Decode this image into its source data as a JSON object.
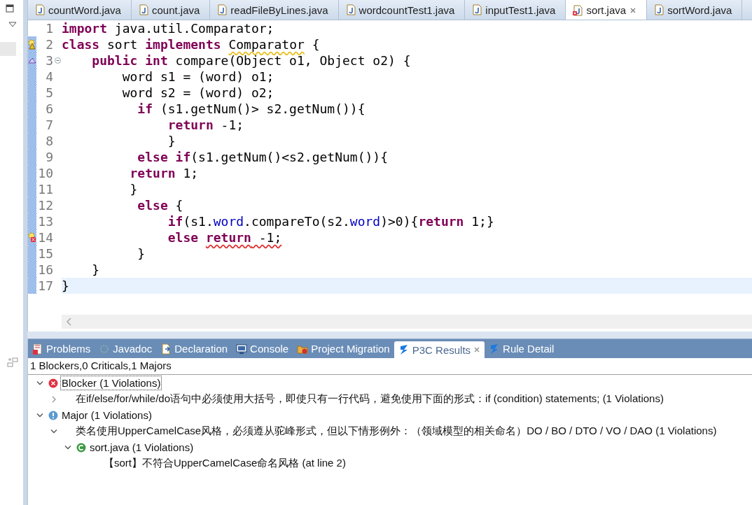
{
  "editor_tabs": [
    {
      "label": "countWord.java",
      "selected": false,
      "error": false
    },
    {
      "label": "count.java",
      "selected": false,
      "error": false
    },
    {
      "label": "readFileByLines.java",
      "selected": false,
      "error": false
    },
    {
      "label": "wordcountTest1.java",
      "selected": false,
      "error": false
    },
    {
      "label": "inputTest1.java",
      "selected": false,
      "error": false
    },
    {
      "label": "sort.java",
      "selected": true,
      "error": true
    },
    {
      "label": "sortWord.java",
      "selected": false,
      "error": false
    }
  ],
  "code_lines": [
    {
      "number": "1",
      "kind": "plain",
      "changed": false,
      "current": false,
      "segments": [
        {
          "text": "import",
          "kind": "keyword"
        },
        {
          "text": " java.util.Comparator;",
          "kind": "plain"
        }
      ]
    },
    {
      "number": "2",
      "kind": "warning",
      "changed": true,
      "current": false,
      "segments": [
        {
          "text": "class",
          "kind": "keyword"
        },
        {
          "text": " sort ",
          "kind": "plain"
        },
        {
          "text": "implements ",
          "kind": "keyword"
        },
        {
          "text": "Comparator",
          "kind": "plain",
          "warning": true
        },
        {
          "text": " {",
          "kind": "plain"
        }
      ]
    },
    {
      "number": "3",
      "kind": "override",
      "expanded": true,
      "changed": true,
      "current": false,
      "segments": [
        {
          "text": "    public int",
          "kind": "keyword"
        },
        {
          "text": " compare(Object o1, Object o2) {",
          "kind": "plain"
        }
      ]
    },
    {
      "number": "4",
      "kind": "plain",
      "changed": true,
      "current": false,
      "segments": [
        {
          "text": "        word s1 = (word) o1;",
          "kind": "plain"
        }
      ]
    },
    {
      "number": "5",
      "kind": "plain",
      "changed": true,
      "current": false,
      "segments": [
        {
          "text": "        word s2 = (word) o2;",
          "kind": "plain"
        }
      ]
    },
    {
      "number": "6",
      "kind": "plain",
      "changed": true,
      "current": false,
      "segments": [
        {
          "text": "          if",
          "kind": "keyword"
        },
        {
          "text": " (s1.getNum()> s2.getNum()){",
          "kind": "plain"
        }
      ]
    },
    {
      "number": "7",
      "kind": "plain",
      "changed": true,
      "current": false,
      "segments": [
        {
          "text": "              return",
          "kind": "keyword"
        },
        {
          "text": " -1;",
          "kind": "plain"
        }
      ]
    },
    {
      "number": "8",
      "kind": "plain",
      "changed": true,
      "current": false,
      "segments": [
        {
          "text": "              }",
          "kind": "plain"
        }
      ]
    },
    {
      "number": "9",
      "kind": "plain",
      "changed": true,
      "current": false,
      "segments": [
        {
          "text": "          else if",
          "kind": "keyword"
        },
        {
          "text": "(s1.getNum()<s2.getNum()){",
          "kind": "plain"
        }
      ]
    },
    {
      "number": "10",
      "kind": "plain",
      "changed": true,
      "current": false,
      "segments": [
        {
          "text": "         return",
          "kind": "keyword"
        },
        {
          "text": " 1;",
          "kind": "plain"
        }
      ]
    },
    {
      "number": "11",
      "kind": "plain",
      "changed": true,
      "current": false,
      "segments": [
        {
          "text": "         }",
          "kind": "plain"
        }
      ]
    },
    {
      "number": "12",
      "kind": "plain",
      "changed": true,
      "current": false,
      "segments": [
        {
          "text": "          else",
          "kind": "keyword"
        },
        {
          "text": " {",
          "kind": "plain"
        }
      ]
    },
    {
      "number": "13",
      "kind": "plain",
      "changed": true,
      "current": false,
      "segments": [
        {
          "text": "              if",
          "kind": "keyword"
        },
        {
          "text": "(s1.",
          "kind": "plain"
        },
        {
          "text": "word",
          "kind": "field"
        },
        {
          "text": ".compareTo(s2.",
          "kind": "plain"
        },
        {
          "text": "word",
          "kind": "field"
        },
        {
          "text": ")>0){",
          "kind": "plain"
        },
        {
          "text": "return",
          "kind": "keyword"
        },
        {
          "text": " 1;}",
          "kind": "plain"
        }
      ]
    },
    {
      "number": "14",
      "kind": "error",
      "changed": true,
      "current": false,
      "segments": [
        {
          "text": "              else ",
          "kind": "keyword"
        },
        {
          "text": "return",
          "kind": "keyword",
          "error": true
        },
        {
          "text": " -1;",
          "kind": "plain",
          "error": true
        }
      ]
    },
    {
      "number": "15",
      "kind": "plain",
      "changed": true,
      "current": false,
      "segments": [
        {
          "text": "          }",
          "kind": "plain"
        }
      ]
    },
    {
      "number": "16",
      "kind": "plain",
      "changed": true,
      "current": false,
      "segments": [
        {
          "text": "    }",
          "kind": "plain"
        }
      ]
    },
    {
      "number": "17",
      "kind": "plain",
      "changed": true,
      "current": true,
      "segments": [
        {
          "text": "}",
          "kind": "plain"
        }
      ]
    }
  ],
  "panel_tabs": [
    {
      "label": "Problems",
      "kind": "problems",
      "selected": false
    },
    {
      "label": "Javadoc",
      "kind": "javadoc",
      "selected": false
    },
    {
      "label": "Declaration",
      "kind": "declaration",
      "selected": false
    },
    {
      "label": "Console",
      "kind": "console",
      "selected": false
    },
    {
      "label": "Project Migration",
      "kind": "migration",
      "selected": false
    },
    {
      "label": "P3C Results",
      "kind": "p3c",
      "selected": true
    },
    {
      "label": "Rule Detail",
      "kind": "p3c",
      "selected": false
    }
  ],
  "summary": "1 Blockers,0 Criticals,1 Majors",
  "tree": [
    {
      "label": "Blocker (1 Violations)",
      "kind": "error",
      "expanded": true,
      "selected": true,
      "children": [
        {
          "label": "在if/else/for/while/do语句中必须使用大括号，即使只有一行代码，避免使用下面的形式：if (condition) statements; (1 Violations)",
          "expanded": false,
          "selected": false
        }
      ]
    },
    {
      "label": "Major (1 Violations)",
      "kind": "info",
      "expanded": true,
      "selected": false,
      "children": [
        {
          "label": "类名使用UpperCamelCase风格，必须遵从驼峰形式，但以下情形例外：（领域模型的相关命名）DO / BO / DTO / VO / DAO (1 Violations)",
          "expanded": true,
          "selected": false,
          "children": [
            {
              "label": "sort.java (1 Violations)",
              "kind": "class",
              "expanded": true,
              "selected": false,
              "children": [
                {
                  "label": "【sort】不符合UpperCamelCase命名风格 (at line 2)",
                  "selected": false
                }
              ]
            }
          ]
        }
      ]
    }
  ]
}
